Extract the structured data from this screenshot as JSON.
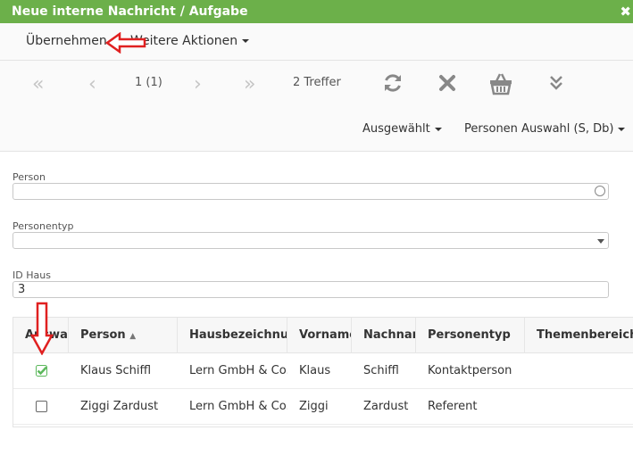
{
  "dialog": {
    "title": "Neue interne Nachricht / Aufgabe",
    "close_icon": "close-icon"
  },
  "actions": {
    "apply_label": "Übernehmen",
    "more_label": "Weitere Aktionen"
  },
  "pager": {
    "page_text": "1 (1)",
    "hits_text": "2 Treffer"
  },
  "toolbar": {
    "icons": [
      "first-page-icon",
      "prev-page-icon",
      "next-page-icon",
      "last-page-icon",
      "refresh-icon",
      "clear-icon",
      "basket-icon",
      "expand-icon"
    ],
    "selected_label": "Ausgewählt",
    "person_selection_label": "Personen Auswahl (S, Db)"
  },
  "filters": {
    "person_label": "Person",
    "person_value": "",
    "persontype_label": "Personentyp",
    "persontype_value": "",
    "house_id_label": "ID Haus",
    "house_id_value": "3"
  },
  "table": {
    "columns": [
      "Auswahl",
      "Person",
      "Hausbezeichnung",
      "Vorname",
      "Nachname",
      "Personentyp",
      "Themenbereich"
    ],
    "sort_column": "Person",
    "rows": [
      {
        "selected": true,
        "person": "Klaus Schiffl",
        "house": "Lern GmbH & Co.",
        "firstname": "Klaus",
        "lastname": "Schiffl",
        "type": "Kontaktperson",
        "topic": ""
      },
      {
        "selected": false,
        "person": "Ziggi Zardust",
        "house": "Lern GmbH & Co.",
        "firstname": "Ziggi",
        "lastname": "Zardust",
        "type": "Referent",
        "topic": ""
      }
    ]
  },
  "colors": {
    "titlebar": "#6cb04a",
    "check": "#5cb85c",
    "annotation_arrow": "#e02020"
  }
}
